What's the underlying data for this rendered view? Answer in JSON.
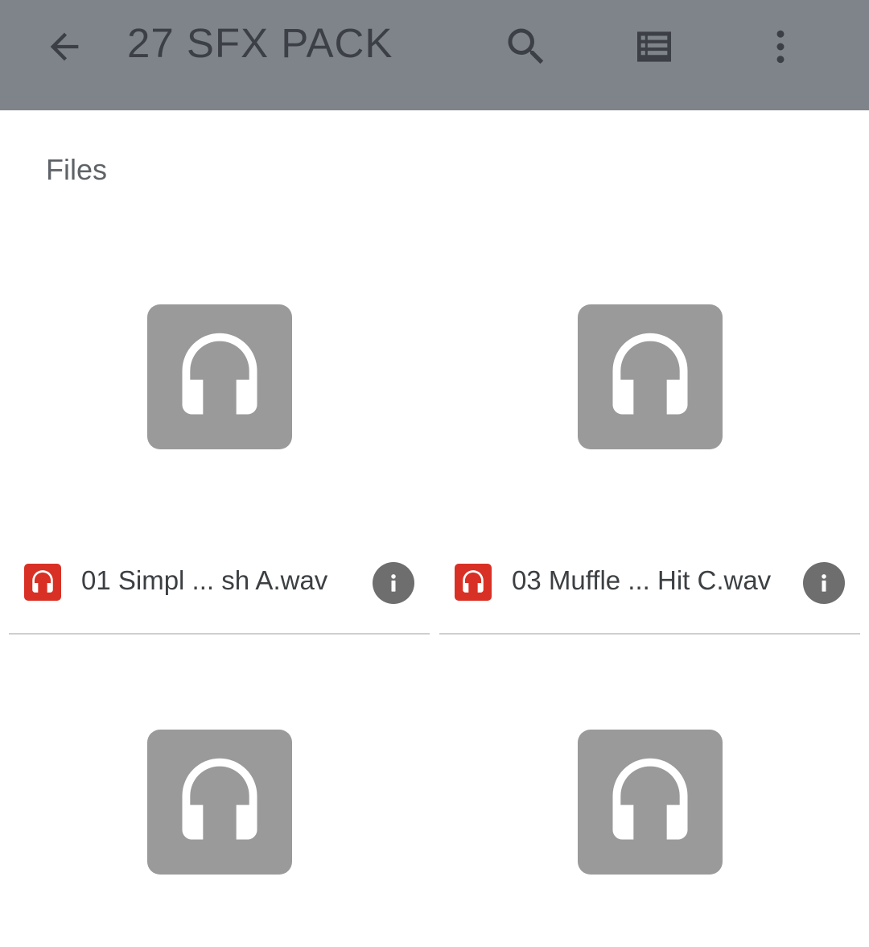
{
  "app_bar": {
    "title": "27 SFX PACK",
    "back_icon": "arrow-back-icon",
    "search_icon": "search-icon",
    "view_icon": "list-view-icon",
    "more_icon": "more-vert-icon",
    "background_color": "#7f848b"
  },
  "section": {
    "label": "Files"
  },
  "files": [
    {
      "name": "01 Simpl ... sh A.wav",
      "type_icon": "headphones-icon",
      "thumbnail_icon": "headphones-icon"
    },
    {
      "name": "03 Muffle ... Hit C.wav",
      "type_icon": "headphones-icon",
      "thumbnail_icon": "headphones-icon"
    },
    {
      "name": "",
      "type_icon": "headphones-icon",
      "thumbnail_icon": "headphones-icon"
    },
    {
      "name": "",
      "type_icon": "headphones-icon",
      "thumbnail_icon": "headphones-icon"
    }
  ],
  "colors": {
    "audio_type_badge": "#d93025",
    "thumbnail_bg": "#9a9a9a",
    "info_button": "#6e6e6e"
  }
}
